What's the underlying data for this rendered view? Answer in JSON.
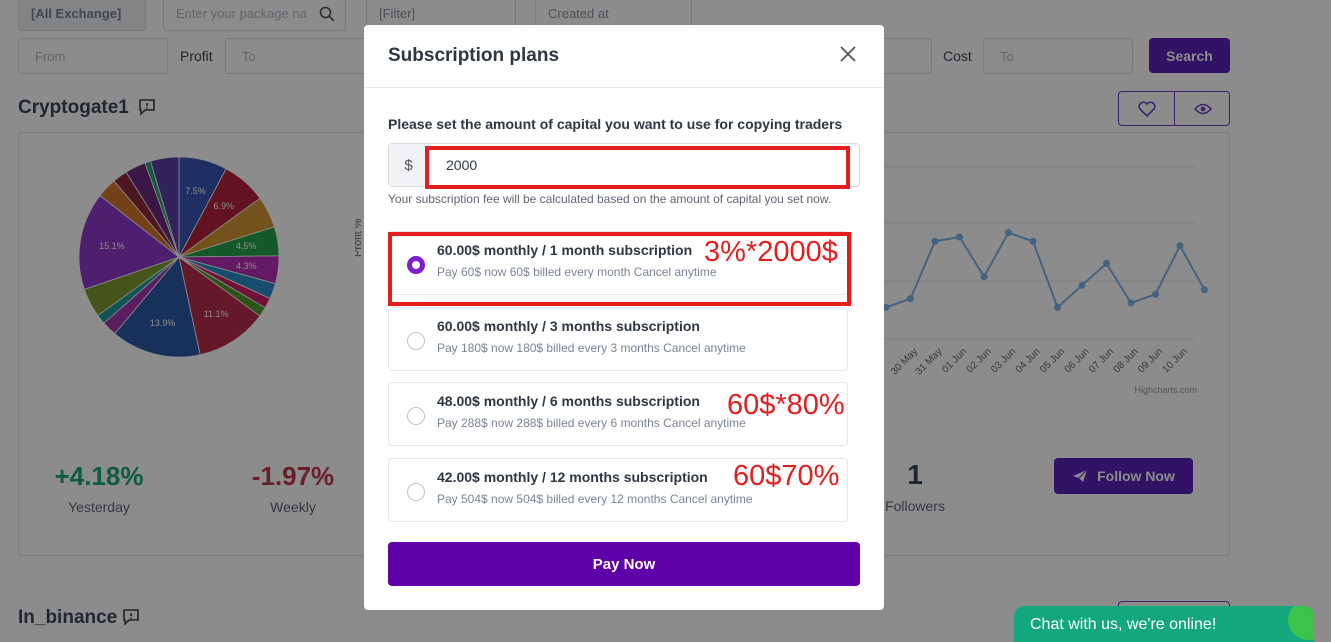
{
  "filters": {
    "exchange_label": "[All Exchange]",
    "package_placeholder": "Enter your package na",
    "filter_label": "[Filter]",
    "created_label": "Created at",
    "from_placeholder": "From",
    "profit_label": "Profit",
    "to_placeholder": "To",
    "cost_label": "Cost",
    "cost_to_placeholder": "To",
    "search_label": "Search"
  },
  "card1": {
    "title": "Cryptogate1",
    "stats": [
      {
        "value": "+4.18%",
        "label": "Yesterday",
        "color": "#1aa67a"
      },
      {
        "value": "-1.97%",
        "label": "Weekly",
        "color": "#c0394b"
      }
    ],
    "followers_count": "1",
    "followers_label": "Followers",
    "follow_button": "Follow Now",
    "chart_y_label": "Profit %",
    "chart_credit": "Highcharts.com",
    "x_dates": [
      "30 May",
      "31 May",
      "01 Jun",
      "02 Jun",
      "03 Jun",
      "04 Jun",
      "05 Jun",
      "06 Jun",
      "07 Jun",
      "08 Jun",
      "09 Jun",
      "10 Jun"
    ]
  },
  "card2": {
    "title": "In_binance"
  },
  "chart_data": [
    {
      "type": "pie",
      "slices": [
        {
          "label": "7.5%",
          "value": 7.5,
          "color": "#3a55b4"
        },
        {
          "label": "6.9%",
          "value": 6.9,
          "color": "#b3243a"
        },
        {
          "label": "",
          "value": 4.9,
          "color": "#d19632"
        },
        {
          "label": "4.5%",
          "value": 4.5,
          "color": "#27a24a"
        },
        {
          "label": "4.3%",
          "value": 4.3,
          "color": "#b52fb5"
        },
        {
          "label": "",
          "value": 2.4,
          "color": "#2b8fc7"
        },
        {
          "label": "",
          "value": 1.6,
          "color": "#d11e6a"
        },
        {
          "label": "",
          "value": 1.5,
          "color": "#4f9a2c"
        },
        {
          "label": "11.1%",
          "value": 11.1,
          "color": "#b82c4a"
        },
        {
          "label": "13.9%",
          "value": 13.9,
          "color": "#2c5aa6"
        },
        {
          "label": "",
          "value": 2.3,
          "color": "#a335b0"
        },
        {
          "label": "",
          "value": 1.5,
          "color": "#1f9aa0"
        },
        {
          "label": "",
          "value": 4.5,
          "color": "#7e9a2c"
        },
        {
          "label": "15.1%",
          "value": 15.1,
          "color": "#8d3ac8"
        },
        {
          "label": "",
          "value": 3.1,
          "color": "#d2762c"
        },
        {
          "label": "",
          "value": 2.3,
          "color": "#8c2a3e"
        },
        {
          "label": "",
          "value": 3.2,
          "color": "#6a2b7c"
        },
        {
          "label": "",
          "value": 0.9,
          "color": "#2aa07a"
        },
        {
          "label": "",
          "value": 4.4,
          "color": "#5a3ea8"
        }
      ]
    },
    {
      "type": "line",
      "series": [
        {
          "values": [
            -0.6,
            -0.4,
            0.9,
            1.0,
            0.1,
            1.1,
            0.9,
            -0.6,
            -0.1,
            0.4,
            -0.5,
            -0.3,
            0.8,
            -0.2
          ]
        }
      ]
    }
  ],
  "modal": {
    "title": "Subscription plans",
    "prompt": "Please set the amount of capital you want to use for copying traders",
    "currency": "$",
    "amount": "2000",
    "hint": "Your subscription fee will be calculated based on the amount of capital you set now.",
    "plans": [
      {
        "title": "60.00$ monthly / 1 month subscription",
        "detail": "Pay 60$ now 60$ billed every month Cancel anytime",
        "selected": true
      },
      {
        "title": "60.00$ monthly / 3 months subscription",
        "detail": "Pay 180$ now 180$ billed every 3 months Cancel anytime",
        "selected": false
      },
      {
        "title": "48.00$ monthly / 6 months subscription",
        "detail": "Pay 288$ now 288$ billed every 6 months Cancel anytime",
        "selected": false
      },
      {
        "title": "42.00$ monthly / 12 months subscription",
        "detail": "Pay 504$ now 504$ billed every 12 months Cancel anytime",
        "selected": false
      }
    ],
    "pay_button": "Pay Now"
  },
  "annotations": [
    "3%*2000$",
    "60$*80%",
    "60$70%"
  ],
  "chat": {
    "label": "Chat with us, we're online!"
  }
}
